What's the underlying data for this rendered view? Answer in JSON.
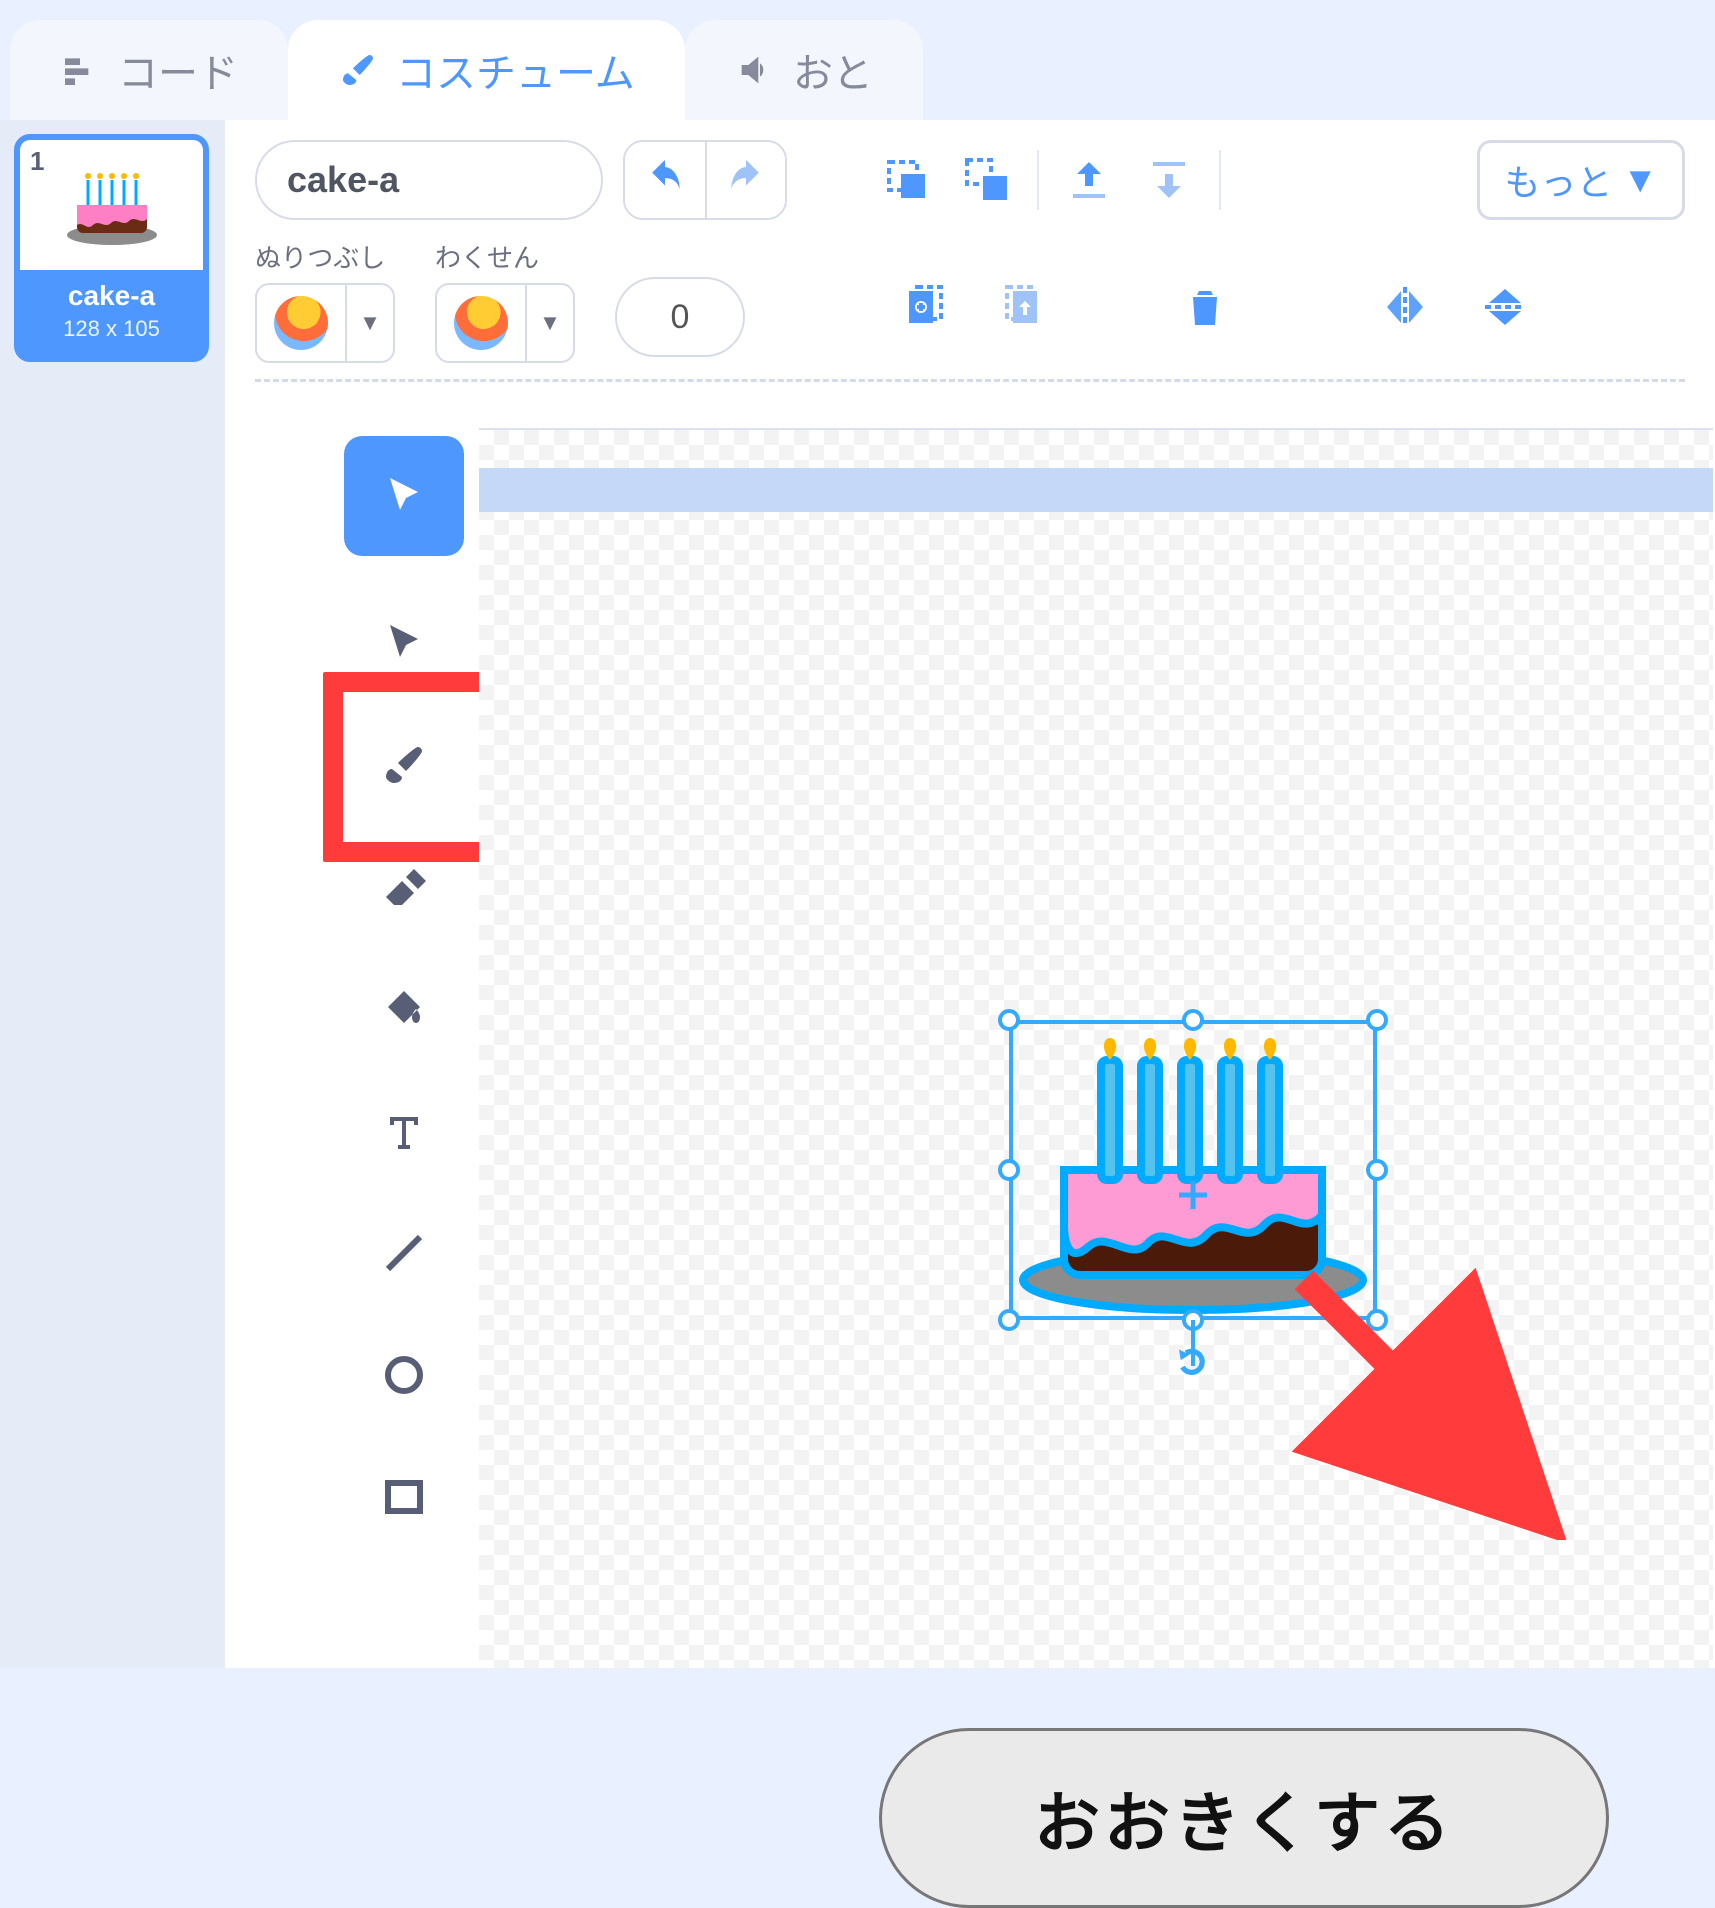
{
  "tabs": {
    "code": "コード",
    "costumes": "コスチューム",
    "sounds": "おと"
  },
  "costume_list": {
    "index": "1",
    "name": "cake-a",
    "size": "128 x 105"
  },
  "toolbar": {
    "name_value": "cake-a",
    "fill_label": "ぬりつぶし",
    "stroke_label": "わくせん",
    "stroke_width": "0",
    "more": "もっと"
  },
  "tools": {
    "select": "select",
    "reshape": "reshape",
    "brush": "brush",
    "eraser": "eraser",
    "fill": "fill",
    "text": "text",
    "line": "line",
    "circle": "circle",
    "rect": "rect"
  },
  "annotation": {
    "callout": "おおきくする"
  }
}
